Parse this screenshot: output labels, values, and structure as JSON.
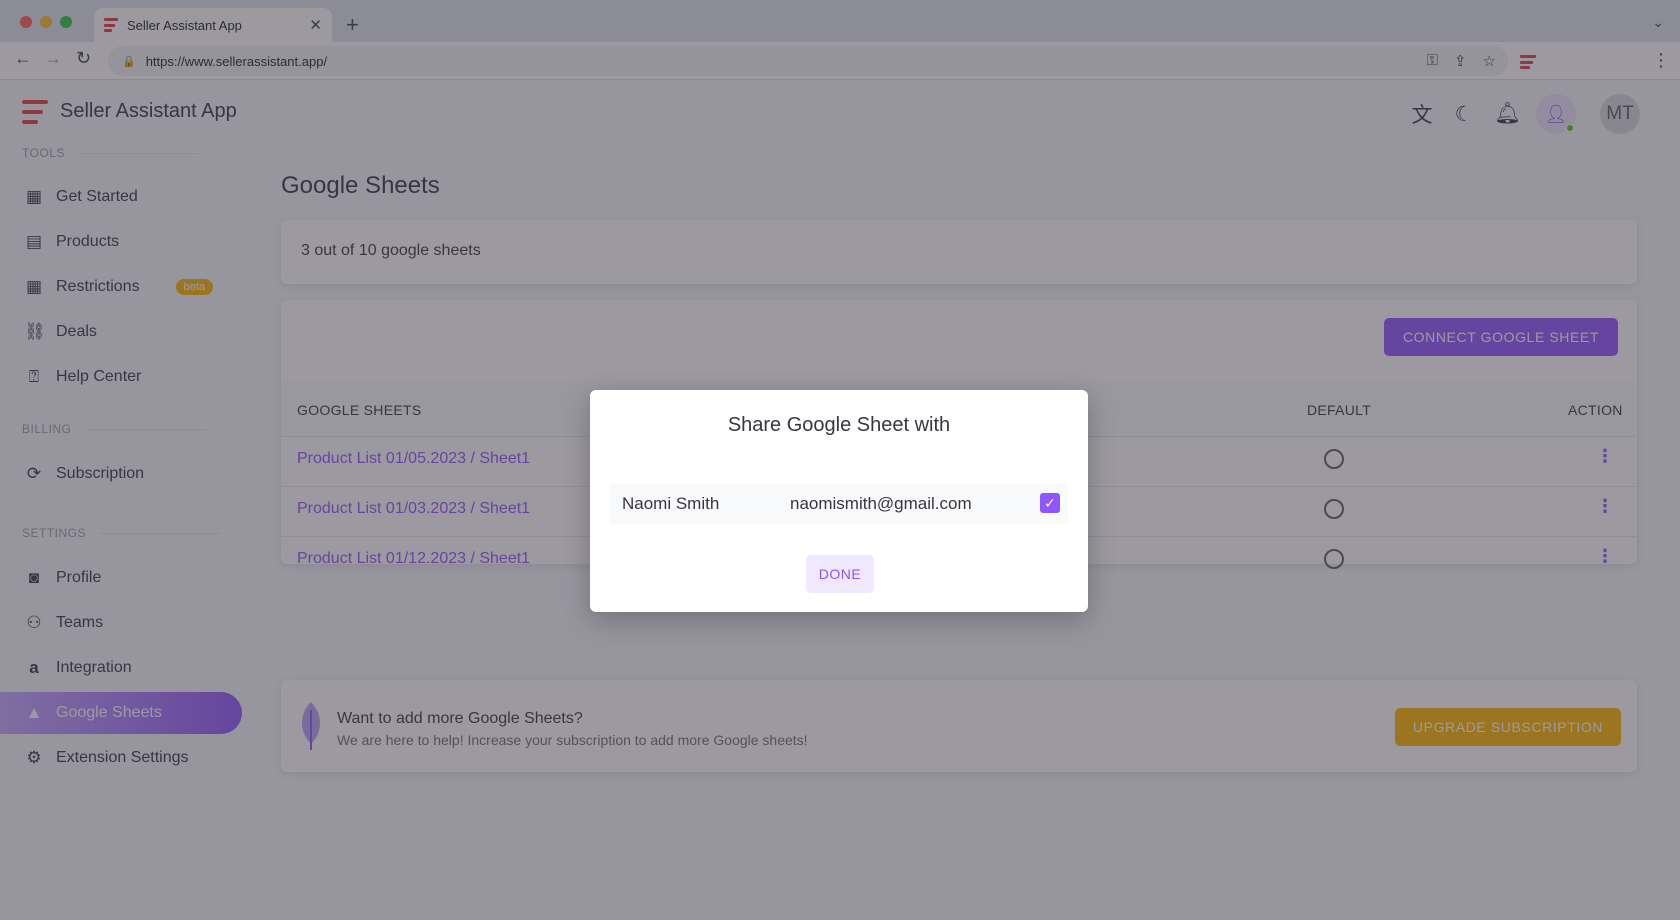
{
  "browser": {
    "tab_title": "Seller Assistant App",
    "url": "https://www.sellerassistant.app/",
    "colors": {
      "close": "#ff5f57",
      "minimize": "#febc2e",
      "zoom": "#28c840"
    }
  },
  "app": {
    "title": "Seller Assistant App",
    "user_initials": "MT",
    "accent": "#9155fd",
    "warning": "#ffb400",
    "brand": "#e23d3d"
  },
  "sidebar": {
    "tools_label": "TOOLS",
    "billing_label": "BILLING",
    "settings_label": "SETTINGS",
    "items": [
      {
        "label": "Get Started",
        "icon": "calendar-icon"
      },
      {
        "label": "Products",
        "icon": "list-icon"
      },
      {
        "label": "Restrictions",
        "icon": "calendar-icon",
        "badge": "beta"
      },
      {
        "label": "Deals",
        "icon": "handshake-icon"
      },
      {
        "label": "Help Center",
        "icon": "help-icon"
      },
      {
        "label": "Subscription",
        "icon": "refresh-icon"
      },
      {
        "label": "Profile",
        "icon": "profile-icon"
      },
      {
        "label": "Teams",
        "icon": "team-icon"
      },
      {
        "label": "Integration",
        "icon": "amazon-icon"
      },
      {
        "label": "Google Sheets",
        "icon": "drive-icon",
        "active": true
      },
      {
        "label": "Extension Settings",
        "icon": "gear-icon"
      }
    ]
  },
  "main": {
    "page_title": "Google Sheets",
    "count_text": "3 out of 10 google sheets",
    "connect_button": "CONNECT GOOGLE SHEET",
    "table": {
      "headers": [
        "GOOGLE SHEETS",
        "DEFAULT",
        "ACTION"
      ],
      "rows": [
        {
          "name": "Product List 01/05.2023 / Sheet1",
          "default": false
        },
        {
          "name": "Product List 01/03.2023 / Sheet1",
          "default": false
        },
        {
          "name": "Product List 01/12.2023 / Sheet1",
          "default": false
        }
      ]
    },
    "promo": {
      "title": "Want to add more Google Sheets?",
      "subtitle": "We are here to help! Increase your subscription to add more Google sheets!",
      "button": "UPGRADE SUBSCRIPTION"
    }
  },
  "dialog": {
    "title": "Share Google Sheet with",
    "name": "Naomi Smith",
    "email": "naomismith@gmail.com",
    "checked": true,
    "done_button": "DONE"
  }
}
